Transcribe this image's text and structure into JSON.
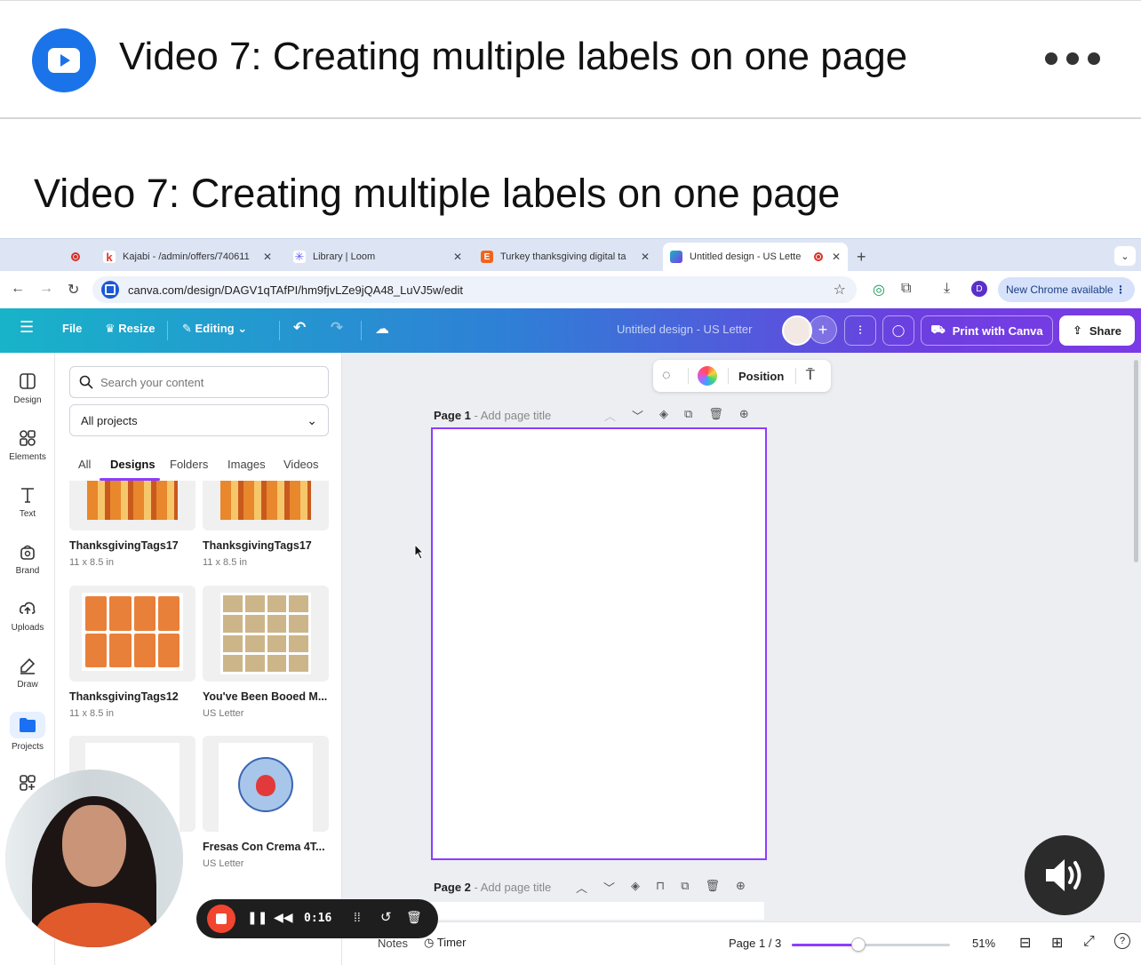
{
  "header": {
    "title": "Video 7: Creating multiple labels on one page",
    "logo_icon": "play-icon",
    "more_icon": "more-horizontal-icon"
  },
  "section": {
    "title": "Video 7: Creating multiple labels on one page"
  },
  "browser": {
    "tabs": [
      {
        "label": "Kajabi - /admin/offers/740611",
        "icon": "kajabi-icon"
      },
      {
        "label": "Library | Loom",
        "icon": "loom-icon"
      },
      {
        "label": "Turkey thanksgiving digital ta",
        "icon": "etsy-icon",
        "icon_text": "E"
      },
      {
        "label": "Untitled design - US Lette",
        "icon": "canva-icon",
        "active": true
      }
    ],
    "url": "canva.com/design/DAGV1qTAfPI/hm9fjvLZe9jQA48_LuVJ5w/edit",
    "profile_initial": "D",
    "chrome_notice": "New Chrome available"
  },
  "canva_toolbar": {
    "file": "File",
    "resize": "Resize",
    "editing": "Editing",
    "design_title": "Untitled design - US Letter",
    "print": "Print with Canva",
    "share": "Share"
  },
  "rail": [
    {
      "label": "Design",
      "icon": "design-icon"
    },
    {
      "label": "Elements",
      "icon": "elements-icon"
    },
    {
      "label": "Text",
      "icon": "text-icon"
    },
    {
      "label": "Brand",
      "icon": "brand-icon"
    },
    {
      "label": "Uploads",
      "icon": "uploads-icon"
    },
    {
      "label": "Draw",
      "icon": "draw-icon"
    },
    {
      "label": "Projects",
      "icon": "folder-icon"
    }
  ],
  "panel": {
    "search_placeholder": "Search your content",
    "filter": "All projects",
    "tabs": [
      "All",
      "Designs",
      "Folders",
      "Images",
      "Videos"
    ],
    "active_tab": "Designs",
    "cards": [
      {
        "name": "ThanksgivingTags17",
        "size": "11 x 8.5 in"
      },
      {
        "name": "ThanksgivingTags17",
        "size": "11 x 8.5 in"
      },
      {
        "name": "ThanksgivingTags12",
        "size": "11 x 8.5 in"
      },
      {
        "name": "You've Been Booed M...",
        "size": "US Letter"
      },
      {
        "name": "",
        "size": ""
      },
      {
        "name": "Fresas Con Crema 4T...",
        "size": "US Letter"
      }
    ]
  },
  "canvas": {
    "float_bar_position": "Position",
    "page1_label": "Page 1",
    "page1_sub": " - Add page title",
    "page2_label": "Page 2",
    "page2_sub": " - Add page title"
  },
  "status": {
    "timer": "Timer",
    "notes": "Notes",
    "page_indicator": "Page 1 / 3",
    "zoom": "51%",
    "zoom_fraction": 0.42
  },
  "recorder": {
    "time": "0:16"
  },
  "colors": {
    "accent": "#8b3dff",
    "brand_blue": "#1a73e8",
    "record_red": "#f2452f"
  }
}
